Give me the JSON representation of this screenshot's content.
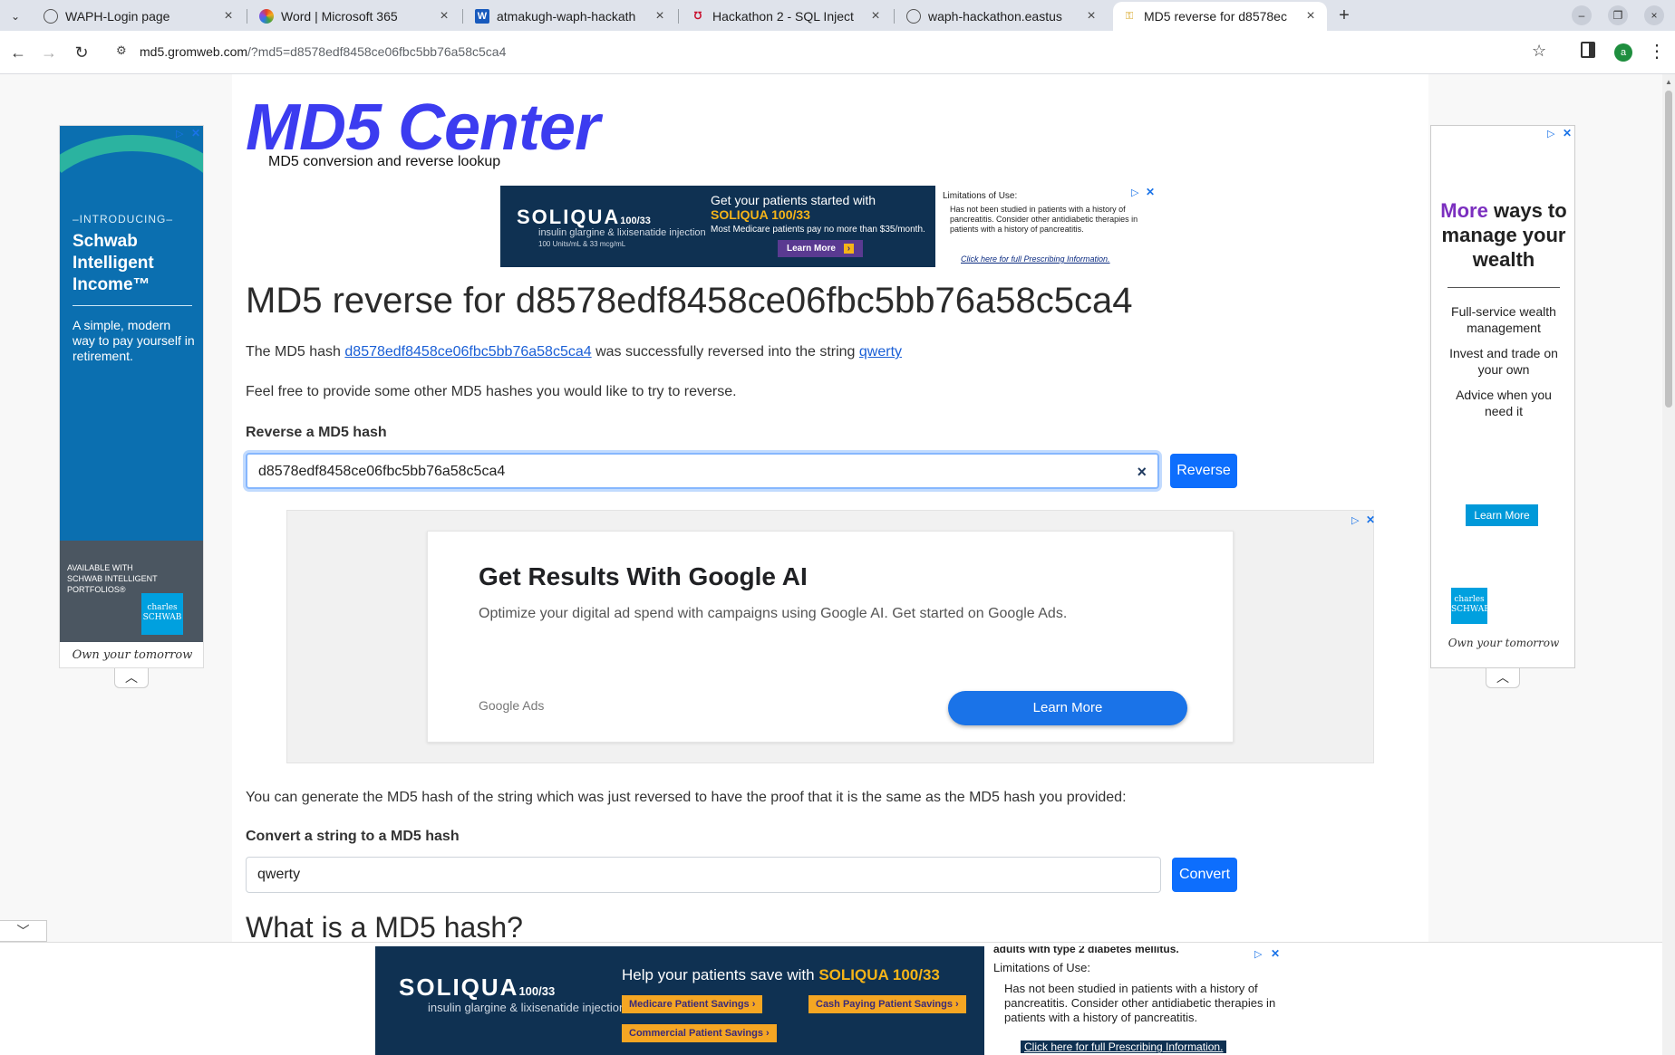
{
  "browser": {
    "tabs": [
      {
        "title": "WAPH-Login page",
        "icon": "globe-icon"
      },
      {
        "title": "Word | Microsoft 365",
        "icon": "microsoft365-icon"
      },
      {
        "title": "atmakugh-waph-hackath",
        "icon": "word-doc-icon"
      },
      {
        "title": "Hackathon 2 - SQL Inject",
        "icon": "uc-logo-icon"
      },
      {
        "title": "waph-hackathon.eastus",
        "icon": "globe-icon"
      },
      {
        "title": "MD5 reverse for d8578ec",
        "icon": "key-icon"
      }
    ],
    "url_host": "md5.gromweb.com",
    "url_path": "/?md5=d8578edf8458ce06fbc5bb76a58c5ca4",
    "profile_initial": "a"
  },
  "page": {
    "logo": "MD5 Center",
    "tagline": "MD5 conversion and reverse lookup",
    "heading": "MD5 reverse for d8578edf8458ce06fbc5bb76a58c5ca4",
    "result": {
      "prefix": "The MD5 hash",
      "hash_link": "d8578edf8458ce06fbc5bb76a58c5ca4",
      "middle": "was successfully reversed into the string",
      "string_link": "qwerty"
    },
    "invite": "Feel free to provide some other MD5 hashes you would like to try to reverse.",
    "reverse_section": {
      "label": "Reverse a MD5 hash",
      "value": "d8578edf8458ce06fbc5bb76a58c5ca4",
      "button": "Reverse"
    },
    "proof_text": "You can generate the MD5 hash of the string which was just reversed to have the proof that it is the same as the MD5 hash you provided:",
    "convert_section": {
      "label": "Convert a string to a MD5 hash",
      "value": "qwerty",
      "button": "Convert"
    },
    "next_heading": "What is a MD5 hash?"
  },
  "ads": {
    "soliqua_top": {
      "logo": "SOLIQUA",
      "logo_suffix": "100/33",
      "sub": "insulin glargine & lixisenatide injection",
      "sub_small": "100 Units/mL & 33 mcg/mL",
      "headline_1": "Get your patients started with",
      "headline_2": "SOLIQUA 100/33",
      "note": "Most Medicare patients pay no more than $35/month.",
      "cta": "Learn More",
      "isi_title": "Limitations of Use:",
      "isi_text": "Has not been studied in patients with a history of pancreatitis. Consider other antidiabetic therapies in patients with a history of pancreatitis.",
      "isi_link": "Click here for full Prescribing Information."
    },
    "schwab_left": {
      "intro": "–INTRODUCING–",
      "title": "Schwab Intelligent Income™",
      "desc": "A simple, modern way to pay yourself in retirement.",
      "avail": "AVAILABLE WITH SCHWAB INTELLIGENT PORTFOLIOS®",
      "logo": "charles SCHWAB",
      "sig": "Own your tomorrow"
    },
    "schwab_right": {
      "head_1": "More",
      "head_2": "ways to manage your wealth",
      "line_1": "Full-service wealth management",
      "line_2": "Invest and trade on your own",
      "line_3": "Advice when you need it",
      "cta": "Learn More",
      "logo": "charles SCHWAB",
      "sig": "Own your tomorrow"
    },
    "google_mid": {
      "title": "Get Results With Google AI",
      "desc": "Optimize your digital ad spend with campaigns using Google AI. Get started on Google Ads.",
      "brand": "Google Ads",
      "cta": "Learn More"
    },
    "soliqua_bottom": {
      "logo": "SOLIQUA",
      "logo_suffix": "100/33",
      "sub": "insulin glargine & lixisenatide injection",
      "headline_1": "Help your patients save with",
      "headline_2": "SOLIQUA 100/33",
      "pill_1": "Medicare Patient Savings",
      "pill_2": "Cash Paying Patient Savings",
      "pill_3": "Commercial Patient Savings",
      "isi_top": "adults with type 2 diabetes mellitus.",
      "isi_title": "Limitations of Use:",
      "isi_text": "Has not been studied in patients with a history of pancreatitis. Consider other antidiabetic therapies in patients with a history of pancreatitis.",
      "isi_link": "Click here for full Prescribing Information."
    }
  },
  "colors": {
    "logo": "#3c3cf0",
    "button": "#0d6efd",
    "link": "#1a5fd6"
  }
}
